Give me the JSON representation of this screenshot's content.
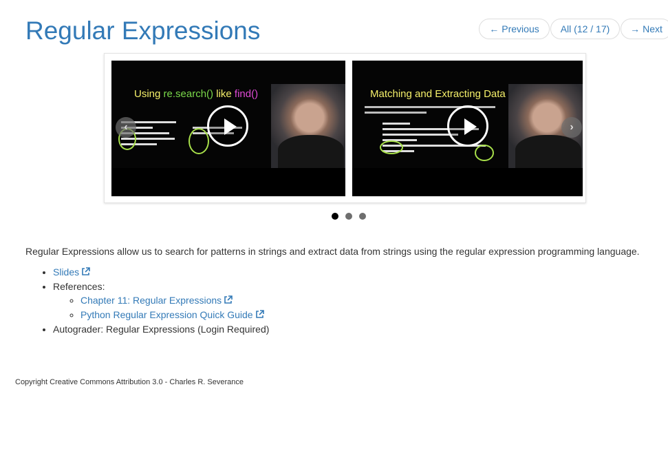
{
  "page": {
    "title": "Regular Expressions"
  },
  "pager": {
    "previous_label": "Previous",
    "all_label": "All (12 / 17)",
    "next_label": "Next",
    "prev_arrow": "←",
    "next_arrow": "→"
  },
  "carousel": {
    "slides": [
      {
        "title_part1": "Using ",
        "title_part2": "re.search()",
        "title_part3": " like ",
        "title_part4": "find()"
      },
      {
        "title": "Matching and Extracting Data"
      }
    ],
    "prev_glyph": "‹",
    "next_glyph": "›",
    "dot_count": 3,
    "active_dot": 1
  },
  "description": "Regular Expressions allow us to search for patterns in strings and extract data from strings using the regular expression programming language.",
  "resources": {
    "slides_label": "Slides",
    "references_label": "References:",
    "reference_links": [
      "Chapter 11: Regular Expressions",
      "Python Regular Expression Quick Guide"
    ],
    "autograder_label": "Autograder: Regular Expressions (Login Required)"
  },
  "footer": {
    "copyright": "Copyright Creative Commons Attribution 3.0 - Charles R. Severance"
  },
  "colors": {
    "link": "#337ab7",
    "title": "#337ab7",
    "active_dot": "#000000",
    "inactive_dot": "#6e6e6e"
  },
  "icons": {
    "external": "external-link-icon",
    "play": "play-icon"
  }
}
